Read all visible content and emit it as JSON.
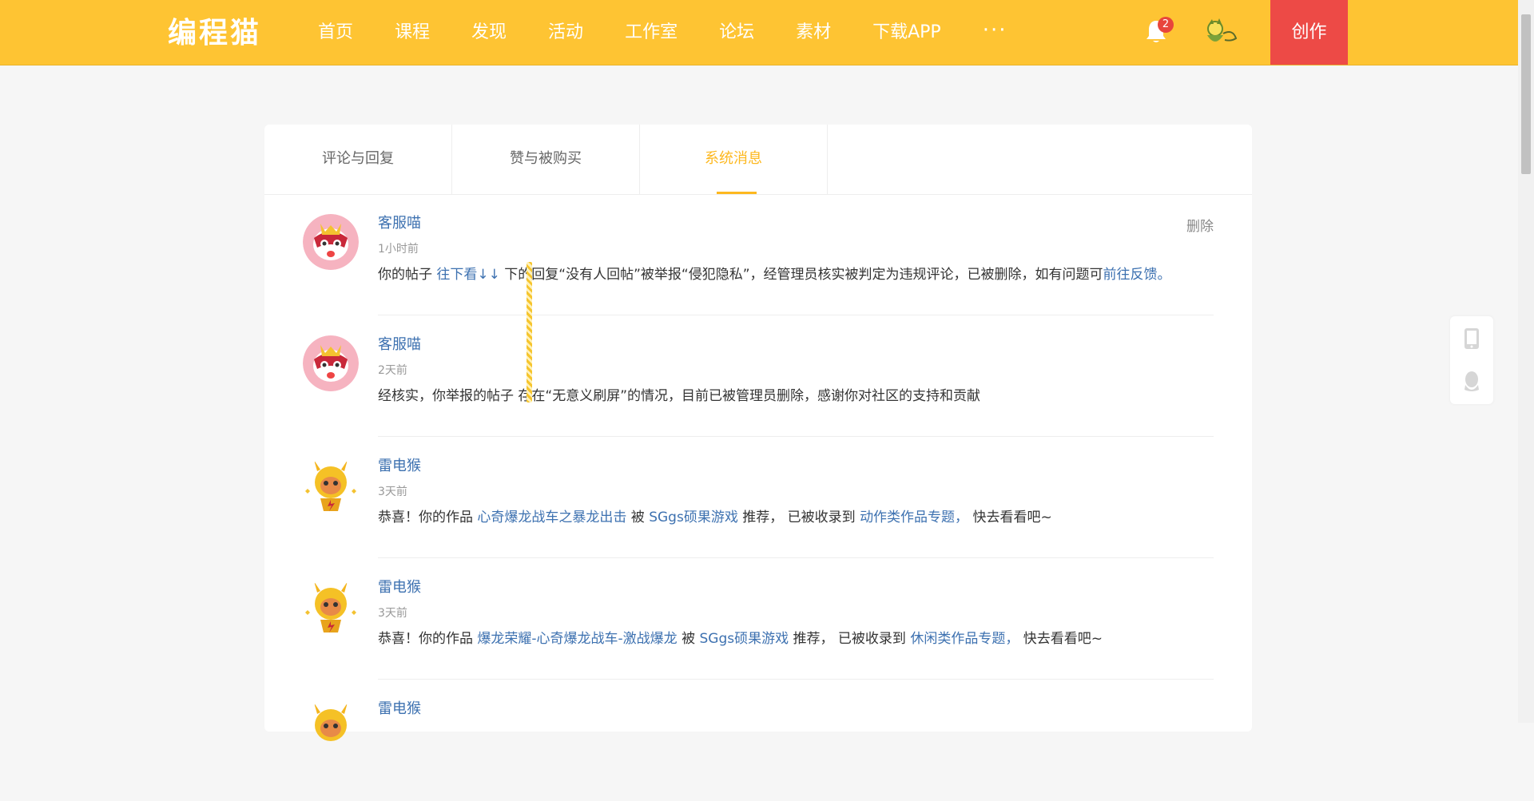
{
  "header": {
    "logo": "编程猫",
    "nav": [
      "首页",
      "课程",
      "发现",
      "活动",
      "工作室",
      "论坛",
      "素材",
      "下载APP"
    ],
    "more": "···",
    "notification_count": "2",
    "create_label": "创作"
  },
  "tabs": {
    "comments": "评论与回复",
    "likes": "赞与被购买",
    "system": "系统消息"
  },
  "messages": [
    {
      "name": "客服喵",
      "time": "1小时前",
      "delete_label": "删除",
      "t1": "你的帖子 ",
      "link1": "往下看↓↓",
      "t2": " 下的回复“没有人回帖”被举报“侵犯隐私”，经管理员核实被判定为违规评论，已被删除，如有问题可",
      "link2": "前往反馈。"
    },
    {
      "name": "客服喵",
      "time": "2天前",
      "t1": "经核实，你举报的帖子 ",
      "t2": " 存在“无意义刷屏”的情况，目前已被管理员删除，感谢你对社区的支持和贡献"
    },
    {
      "name": "雷电猴",
      "time": "3天前",
      "t1": "恭喜！你的作品 ",
      "link1": "心奇爆龙战车之暴龙出击",
      "t2": " 被 ",
      "link2": "SGgs硕果游戏",
      "t3": " 推荐， 已被收录到 ",
      "link3": "动作类作品专题，",
      "t4": " 快去看看吧~"
    },
    {
      "name": "雷电猴",
      "time": "3天前",
      "t1": "恭喜！你的作品 ",
      "link1": "爆龙荣耀-心奇爆龙战车-激战爆龙",
      "t2": " 被 ",
      "link2": "SGgs硕果游戏",
      "t3": " 推荐， 已被收录到 ",
      "link3": "休闲类作品专题，",
      "t4": " 快去看看吧~"
    },
    {
      "name": "雷电猴"
    }
  ],
  "colors": {
    "header_bg": "#fec433",
    "create_bg": "#ed4a46",
    "link": "#3d71b0",
    "active_tab": "#fdb81f"
  }
}
